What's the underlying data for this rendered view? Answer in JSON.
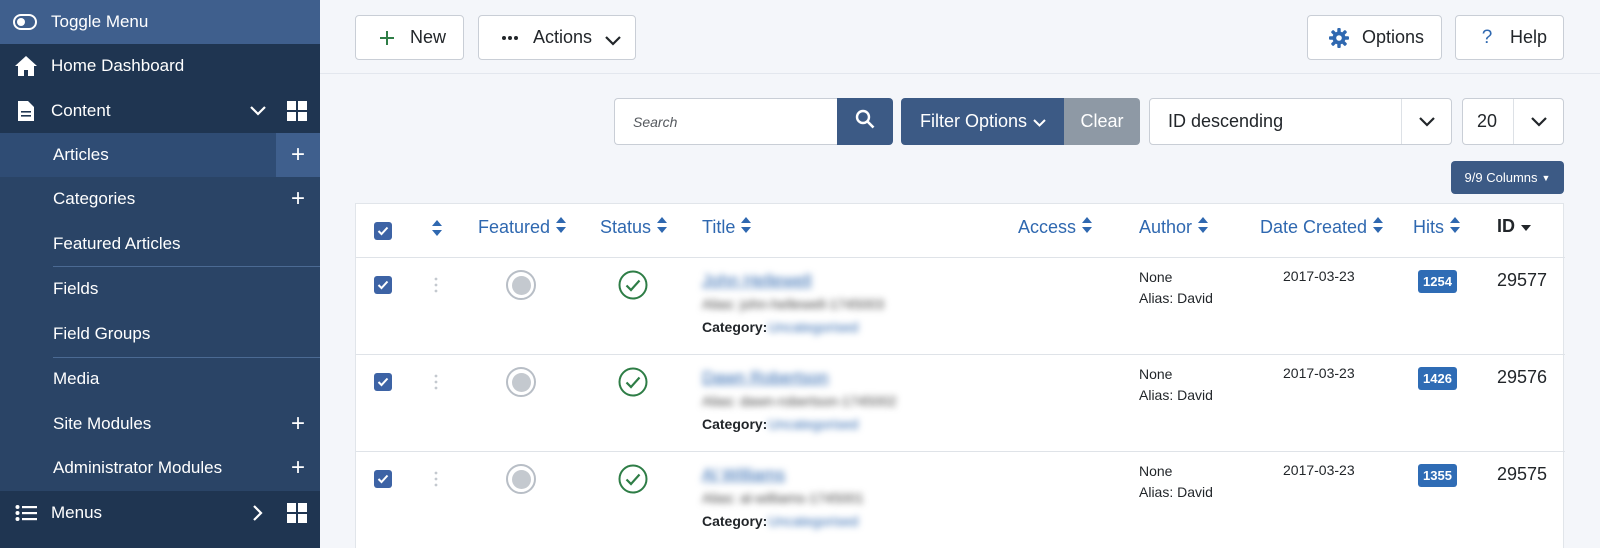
{
  "sidebar": {
    "toggle_label": "Toggle Menu",
    "home_label": "Home Dashboard",
    "content_label": "Content",
    "items": [
      {
        "label": "Articles"
      },
      {
        "label": "Categories"
      },
      {
        "label": "Featured Articles"
      },
      {
        "label": "Fields"
      },
      {
        "label": "Field Groups"
      },
      {
        "label": "Media"
      },
      {
        "label": "Site Modules"
      },
      {
        "label": "Administrator Modules"
      }
    ],
    "menus_label": "Menus"
  },
  "toolbar": {
    "new_label": "New",
    "actions_label": "Actions",
    "options_label": "Options",
    "help_label": "Help"
  },
  "filters": {
    "search_placeholder": "Search",
    "filter_options_label": "Filter Options",
    "clear_label": "Clear",
    "ordering_value": "ID descending",
    "limit_value": "20",
    "columns_label": "9/9 Columns"
  },
  "table": {
    "headers": {
      "featured": "Featured",
      "status": "Status",
      "title": "Title",
      "access": "Access",
      "author": "Author",
      "date_created": "Date Created",
      "hits": "Hits",
      "id": "ID"
    },
    "category_label": "Category:",
    "rows": [
      {
        "title": "John Hellewell",
        "alias": "Alias: john-hellewell-1745003",
        "category": "Uncategorised",
        "author": "None",
        "author_alias": "Alias: David",
        "date": "2017-03-23",
        "hits": "1254",
        "id": "29577"
      },
      {
        "title": "Dawn Robertson",
        "alias": "Alias: dawn-robertson-1745002",
        "category": "Uncategorised",
        "author": "None",
        "author_alias": "Alias: David",
        "date": "2017-03-23",
        "hits": "1426",
        "id": "29576"
      },
      {
        "title": "Al Williams",
        "alias": "Alias: al-williams-1745001",
        "category": "Uncategorised",
        "author": "None",
        "author_alias": "Alias: David",
        "date": "2017-03-23",
        "hits": "1355",
        "id": "29575"
      }
    ]
  },
  "colors": {
    "sidebar_bg": "#1f3551",
    "accent": "#3c5a85",
    "link": "#2f68b0",
    "published_green": "#2e7d46"
  }
}
